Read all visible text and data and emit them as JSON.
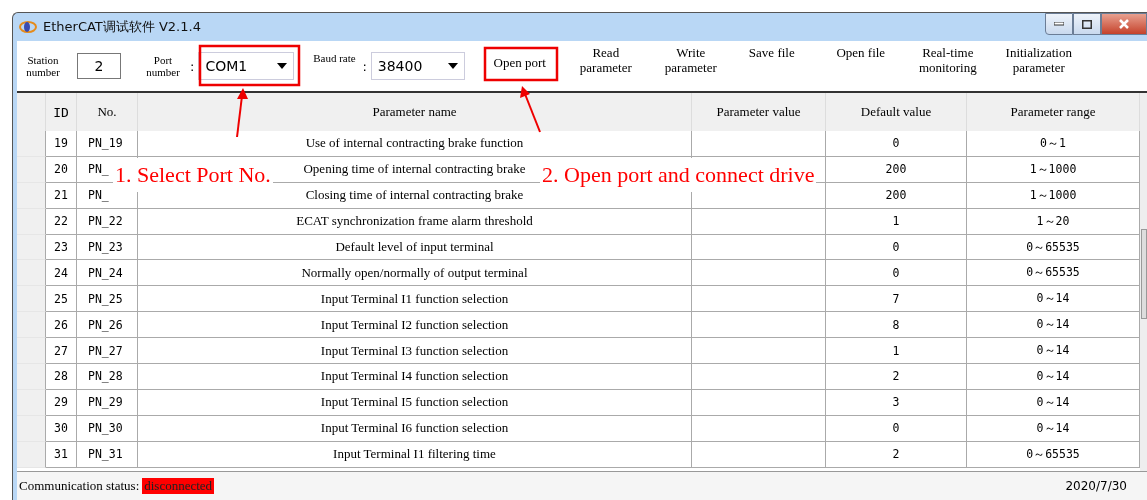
{
  "window": {
    "title": "EtherCAT调试软件 V2.1.4"
  },
  "toolbar": {
    "station_label": "Station number",
    "station_value": "2",
    "port_label": "Port number",
    "port_colon": ":",
    "port_value": "COM1",
    "baud_label": "Baud rate",
    "baud_colon": ":",
    "baud_value": "38400",
    "buttons": [
      "Open port",
      "Read parameter",
      "Write parameter",
      "Save file",
      "Open file",
      "Real-time monitoring",
      "Initialization parameter"
    ]
  },
  "table": {
    "columns": [
      "ID",
      "No.",
      "Parameter name",
      "Parameter value",
      "Default value",
      "Parameter range"
    ],
    "rows": [
      {
        "id": "19",
        "no": "PN_19",
        "name": "Use of internal contracting brake function",
        "default": "0",
        "range": "0～1"
      },
      {
        "id": "20",
        "no": "PN_",
        "name": "Opening time of internal contracting brake",
        "default": "200",
        "range": "1～1000"
      },
      {
        "id": "21",
        "no": "PN_",
        "name": "Closing time of internal contracting brake",
        "default": "200",
        "range": "1～1000"
      },
      {
        "id": "22",
        "no": "PN_22",
        "name": "ECAT synchronization frame alarm threshold",
        "default": "1",
        "range": "1～20"
      },
      {
        "id": "23",
        "no": "PN_23",
        "name": "Default level of input terminal",
        "default": "0",
        "range": "0～65535"
      },
      {
        "id": "24",
        "no": "PN_24",
        "name": "Normally open/normally of output terminal",
        "default": "0",
        "range": "0～65535"
      },
      {
        "id": "25",
        "no": "PN_25",
        "name": "Input Terminal I1 function selection",
        "default": "7",
        "range": "0～14"
      },
      {
        "id": "26",
        "no": "PN_26",
        "name": "Input Terminal I2 function selection",
        "default": "8",
        "range": "0～14"
      },
      {
        "id": "27",
        "no": "PN_27",
        "name": "Input Terminal I3 function selection",
        "default": "1",
        "range": "0～14"
      },
      {
        "id": "28",
        "no": "PN_28",
        "name": "Input Terminal I4 function selection",
        "default": "2",
        "range": "0～14"
      },
      {
        "id": "29",
        "no": "PN_29",
        "name": "Input Terminal I5 function selection",
        "default": "3",
        "range": "0～14"
      },
      {
        "id": "30",
        "no": "PN_30",
        "name": "Input Terminal I6 function selection",
        "default": "0",
        "range": "0～14"
      },
      {
        "id": "31",
        "no": "PN_31",
        "name": "Input Terminal I1 filtering time",
        "default": "2",
        "range": "0～65535"
      }
    ]
  },
  "status_bar": {
    "label": "Communication status:",
    "status": "disconnected",
    "date": "2020/7/30"
  },
  "annotations": [
    "1. Select Port No.",
    "2. Open port and connect drive"
  ]
}
